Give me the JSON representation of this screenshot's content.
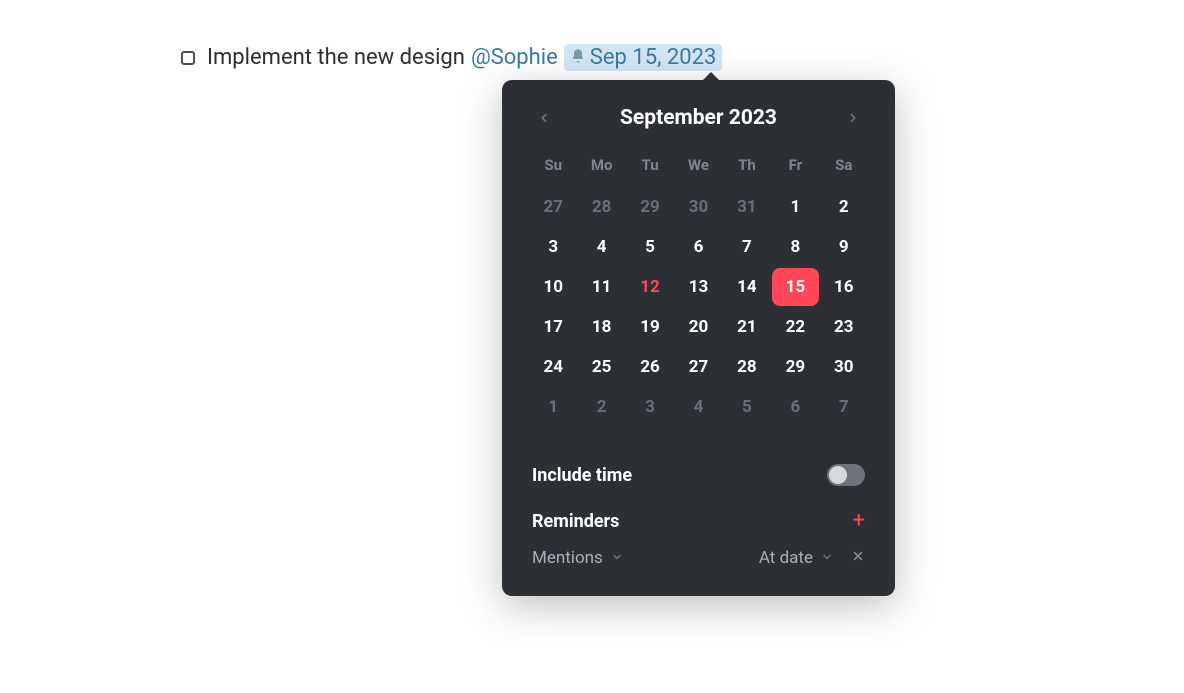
{
  "task": {
    "text": "Implement the new design",
    "mention": "@Sophie",
    "date_label": "Sep 15, 2023"
  },
  "calendar": {
    "title": "September 2023",
    "weekdays": [
      "Su",
      "Mo",
      "Tu",
      "We",
      "Th",
      "Fr",
      "Sa"
    ],
    "days": [
      {
        "n": "27",
        "other": true
      },
      {
        "n": "28",
        "other": true
      },
      {
        "n": "29",
        "other": true
      },
      {
        "n": "30",
        "other": true
      },
      {
        "n": "31",
        "other": true
      },
      {
        "n": "1"
      },
      {
        "n": "2"
      },
      {
        "n": "3"
      },
      {
        "n": "4"
      },
      {
        "n": "5"
      },
      {
        "n": "6"
      },
      {
        "n": "7"
      },
      {
        "n": "8"
      },
      {
        "n": "9"
      },
      {
        "n": "10"
      },
      {
        "n": "11"
      },
      {
        "n": "12",
        "today": true
      },
      {
        "n": "13"
      },
      {
        "n": "14"
      },
      {
        "n": "15",
        "selected": true
      },
      {
        "n": "16"
      },
      {
        "n": "17"
      },
      {
        "n": "18"
      },
      {
        "n": "19"
      },
      {
        "n": "20"
      },
      {
        "n": "21"
      },
      {
        "n": "22"
      },
      {
        "n": "23"
      },
      {
        "n": "24"
      },
      {
        "n": "25"
      },
      {
        "n": "26"
      },
      {
        "n": "27"
      },
      {
        "n": "28"
      },
      {
        "n": "29"
      },
      {
        "n": "30"
      },
      {
        "n": "1",
        "other": true
      },
      {
        "n": "2",
        "other": true
      },
      {
        "n": "3",
        "other": true
      },
      {
        "n": "4",
        "other": true
      },
      {
        "n": "5",
        "other": true
      },
      {
        "n": "6",
        "other": true
      },
      {
        "n": "7",
        "other": true
      }
    ]
  },
  "include_time": {
    "label": "Include time",
    "value": false
  },
  "reminders": {
    "label": "Reminders",
    "type_label": "Mentions",
    "when_label": "At date"
  }
}
